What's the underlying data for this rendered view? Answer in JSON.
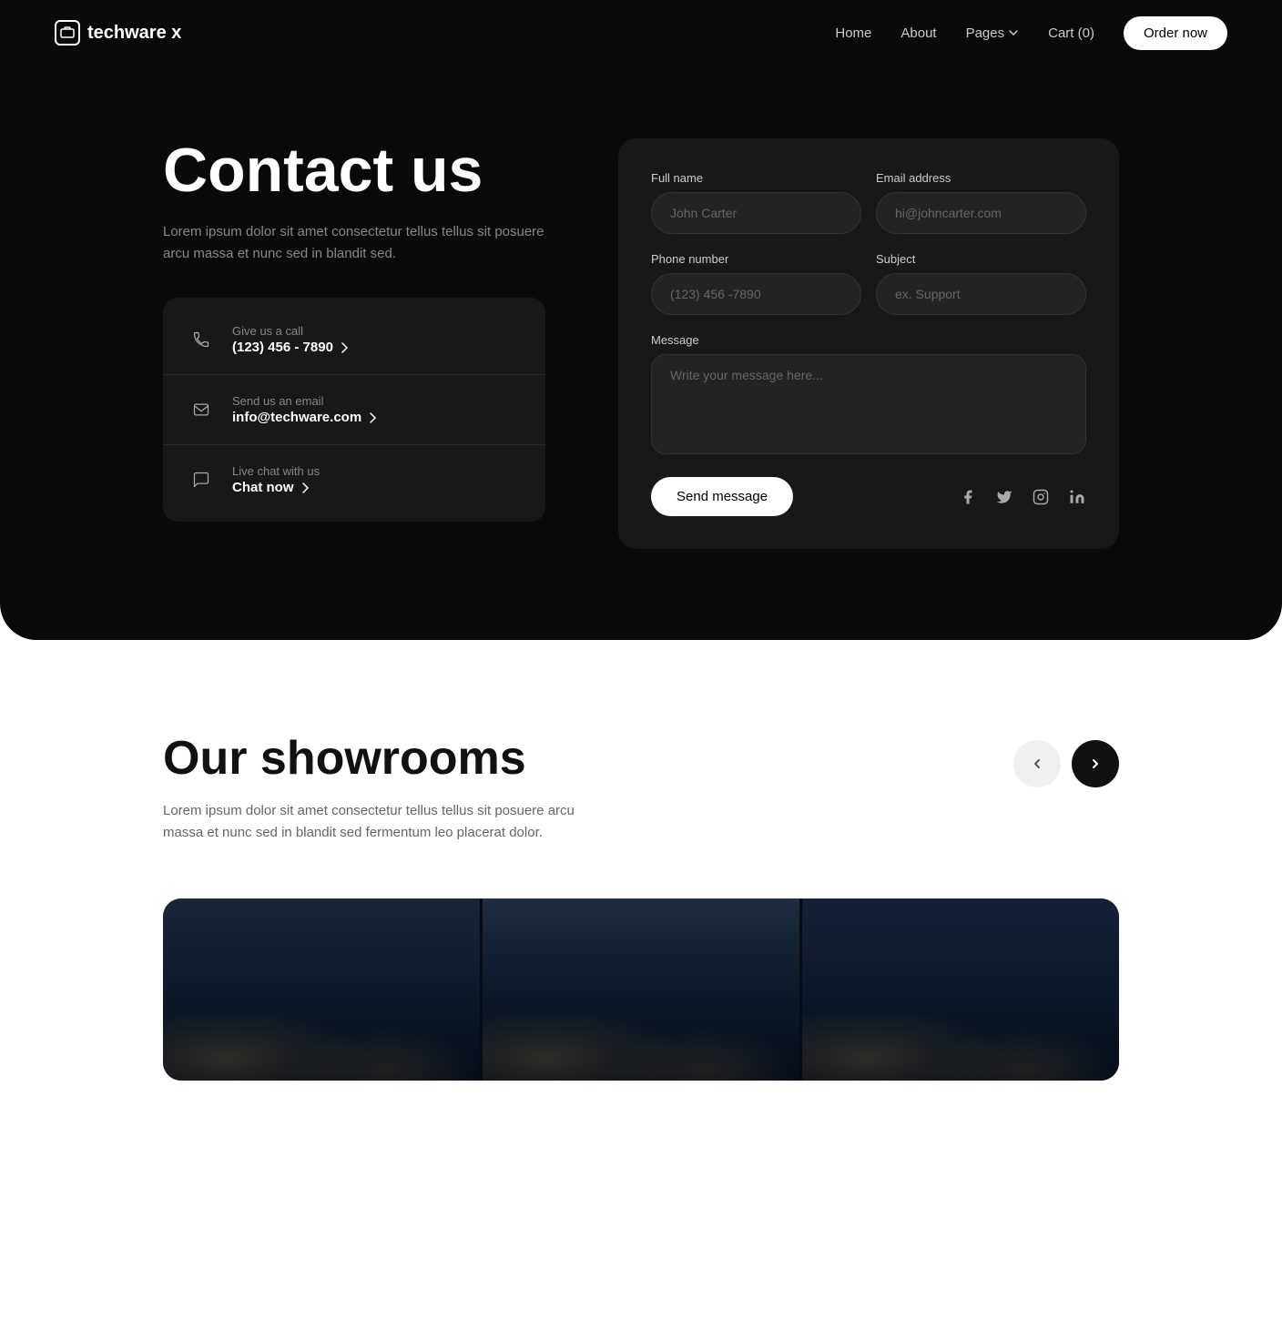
{
  "nav": {
    "logo_text": "techware x",
    "links": [
      {
        "label": "Home",
        "href": "#"
      },
      {
        "label": "About",
        "href": "#"
      },
      {
        "label": "Pages",
        "href": "#",
        "has_dropdown": true
      },
      {
        "label": "Cart (0)",
        "href": "#"
      }
    ],
    "order_btn": "Order now"
  },
  "hero": {
    "title": "Contact us",
    "description": "Lorem ipsum dolor sit amet consectetur tellus tellus sit posuere arcu massa et nunc sed in blandit sed.",
    "contact_cards": [
      {
        "label": "Give us a call",
        "value": "(123) 456 - 7890",
        "icon": "phone"
      },
      {
        "label": "Send us an email",
        "value": "info@techware.com",
        "icon": "email"
      },
      {
        "label": "Live chat with us",
        "value": "Chat now",
        "icon": "chat"
      }
    ]
  },
  "form": {
    "full_name_label": "Full name",
    "full_name_placeholder": "John Carter",
    "email_label": "Email address",
    "email_placeholder": "hi@johncarter.com",
    "phone_label": "Phone number",
    "phone_placeholder": "(123) 456 -7890",
    "subject_label": "Subject",
    "subject_placeholder": "ex. Support",
    "message_label": "Message",
    "message_placeholder": "Write your message here...",
    "submit_label": "Send message"
  },
  "social": {
    "icons": [
      "facebook",
      "twitter",
      "instagram",
      "linkedin"
    ]
  },
  "showrooms": {
    "title": "Our showrooms",
    "description": "Lorem ipsum dolor sit amet consectetur tellus tellus sit posuere arcu massa et nunc sed in blandit sed fermentum leo placerat dolor."
  }
}
